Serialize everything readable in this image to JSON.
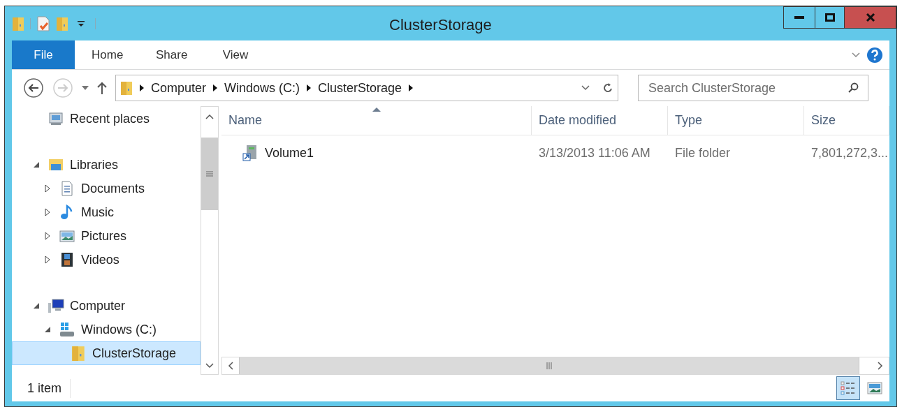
{
  "window": {
    "title": "ClusterStorage"
  },
  "ribbon_tabs": [
    {
      "label": "File",
      "selected": true
    },
    {
      "label": "Home",
      "selected": false
    },
    {
      "label": "Share",
      "selected": false
    },
    {
      "label": "View",
      "selected": false
    }
  ],
  "address_bar": {
    "crumbs": [
      "Computer",
      "Windows (C:)",
      "ClusterStorage"
    ]
  },
  "search": {
    "placeholder": "Search ClusterStorage"
  },
  "nav_tree": [
    {
      "label": "Recent places",
      "kind": "recent",
      "selected": false
    },
    {
      "label": "Libraries",
      "kind": "library",
      "expanded": true,
      "selected": false,
      "children": [
        {
          "label": "Documents",
          "kind": "document",
          "expanded": false,
          "selected": false
        },
        {
          "label": "Music",
          "kind": "music",
          "expanded": false,
          "selected": false
        },
        {
          "label": "Pictures",
          "kind": "pictures",
          "expanded": false,
          "selected": false
        },
        {
          "label": "Videos",
          "kind": "videos",
          "expanded": false,
          "selected": false
        }
      ]
    },
    {
      "label": "Computer",
      "kind": "computer",
      "expanded": true,
      "selected": false,
      "children": [
        {
          "label": "Windows (C:)",
          "kind": "drive",
          "expanded": true,
          "selected": false,
          "children": [
            {
              "label": "ClusterStorage",
              "kind": "folder",
              "selected": true
            }
          ]
        }
      ]
    }
  ],
  "table": {
    "columns": [
      {
        "label": "Name",
        "sorted": true
      },
      {
        "label": "Date modified",
        "sorted": false
      },
      {
        "label": "Type",
        "sorted": false
      },
      {
        "label": "Size",
        "sorted": false
      }
    ],
    "rows": [
      {
        "name": "Volume1",
        "date_modified": "3/13/2013 11:06 AM",
        "type": "File folder",
        "size": "7,801,272,3..."
      }
    ]
  },
  "status_bar": {
    "count": "1 item",
    "views": [
      {
        "kind": "details",
        "selected": true
      },
      {
        "kind": "large_icons",
        "selected": false
      }
    ]
  }
}
